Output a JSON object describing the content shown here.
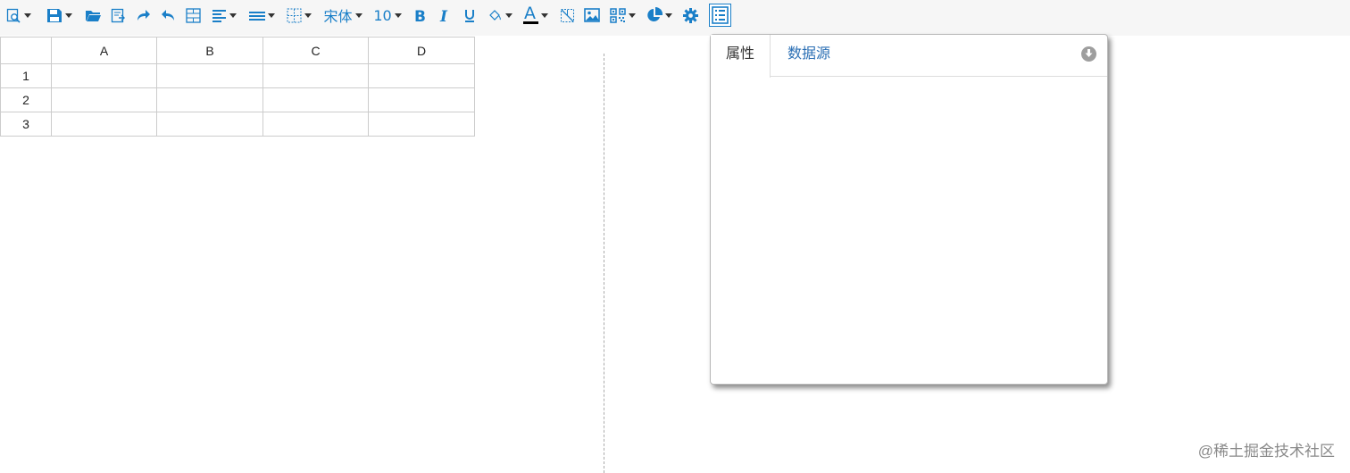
{
  "toolbar": {
    "font_name": "宋体",
    "font_size": "10",
    "icons": [
      "preview-icon",
      "save-icon",
      "open-folder-icon",
      "export-icon",
      "redo-icon",
      "undo-icon",
      "merge-cells-icon",
      "align-horizontal-icon",
      "align-vertical-icon",
      "borders-icon",
      "font-family-select",
      "font-size-select",
      "bold-icon",
      "italic-icon",
      "underline-icon",
      "fill-color-icon",
      "font-color-icon",
      "clear-format-icon",
      "image-icon",
      "qrcode-icon",
      "chart-icon",
      "settings-icon",
      "list-panel-icon"
    ],
    "accent_color": "#1a7fc8"
  },
  "sheet": {
    "columns": [
      "A",
      "B",
      "C",
      "D"
    ],
    "rows": [
      "1",
      "2",
      "3"
    ]
  },
  "panel": {
    "tabs": [
      {
        "label": "属性",
        "active": true
      },
      {
        "label": "数据源",
        "active": false
      }
    ]
  },
  "watermark": "@稀土掘金技术社区"
}
